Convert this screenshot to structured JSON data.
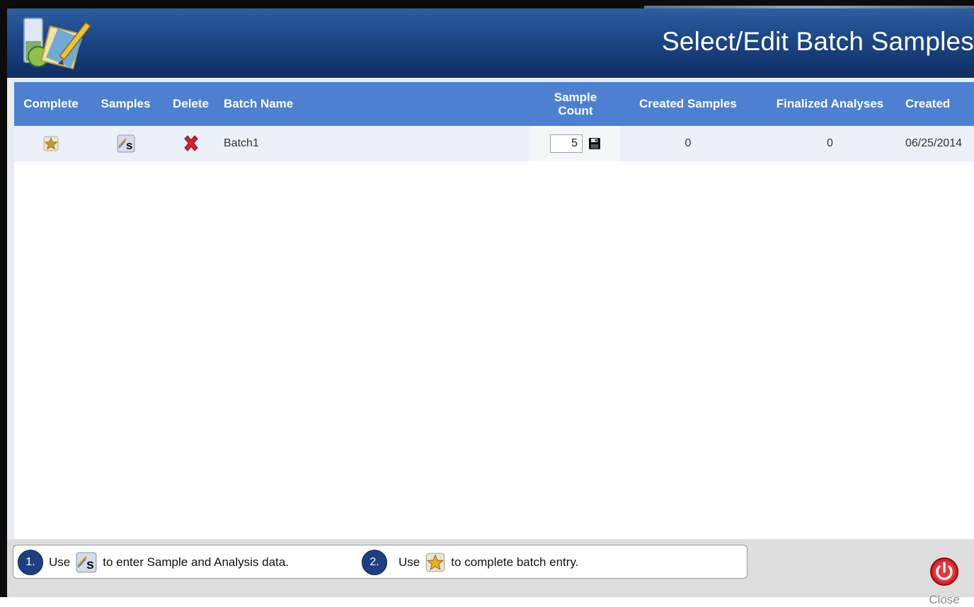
{
  "window": {
    "title": "Select/Edit Batch Samples"
  },
  "table": {
    "headers": {
      "complete": "Complete",
      "samples": "Samples",
      "delete": "Delete",
      "batch_name": "Batch Name",
      "sample_count_line1": "Sample",
      "sample_count_line2": "Count",
      "created_samples": "Created Samples",
      "finalized_analyses": "Finalized Analyses",
      "created": "Created"
    },
    "rows": [
      {
        "complete_icon": "star-icon",
        "samples_icon": "sample-edit-icon",
        "delete_icon": "red-x-icon",
        "batch_name": "Batch1",
        "sample_count": "5",
        "save_icon": "floppy-disk-icon",
        "created_samples": "0",
        "finalized_analyses": "0",
        "created": "06/25/2014"
      }
    ]
  },
  "footer": {
    "step1": {
      "number": "1.",
      "prefix": "Use",
      "icon": "sample-edit-icon",
      "text": "to enter Sample and Analysis data."
    },
    "step2": {
      "number": "2.",
      "prefix": "Use",
      "icon": "star-icon",
      "text": "to complete batch entry."
    },
    "close_label": "Close",
    "close_icon": "power-icon"
  },
  "colors": {
    "title_bar": "#1c4686",
    "header_row": "#4e80d1",
    "data_row": "#ecf0f8",
    "badge": "#1c3f80",
    "close_red": "#d8222a"
  }
}
